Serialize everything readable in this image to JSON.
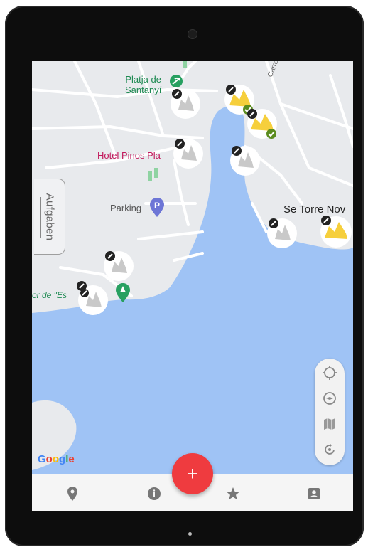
{
  "map": {
    "places": {
      "platja": [
        "Platja de",
        "Santanyí"
      ],
      "hotel": "Hotel Pinos Pla",
      "parking": "Parking",
      "torre": "Se Torre Nov",
      "mirador": "or de \"Es",
      "street": "Carrer de sa Torre"
    },
    "colors": {
      "water": "#9fc3f5",
      "land": "#e8eaed",
      "road": "#ffffff",
      "green_place": "#27a060",
      "hotel": "#c2185b",
      "parking": "#6d76d6",
      "marker_done": "#f6cf3c",
      "check": "#5b8c1f",
      "fab": "#ef3b3f"
    },
    "google_logo": "Google",
    "aufgaben_tab": "Aufgaben"
  },
  "controls": {
    "icons": [
      "crosshair-icon",
      "compass-icon",
      "map-layers-icon",
      "rotate-reset-icon"
    ]
  },
  "bottom_nav": {
    "icons": [
      "location-pin-icon",
      "info-icon",
      "star-icon",
      "contact-icon"
    ]
  },
  "fab": {
    "label": "+"
  }
}
